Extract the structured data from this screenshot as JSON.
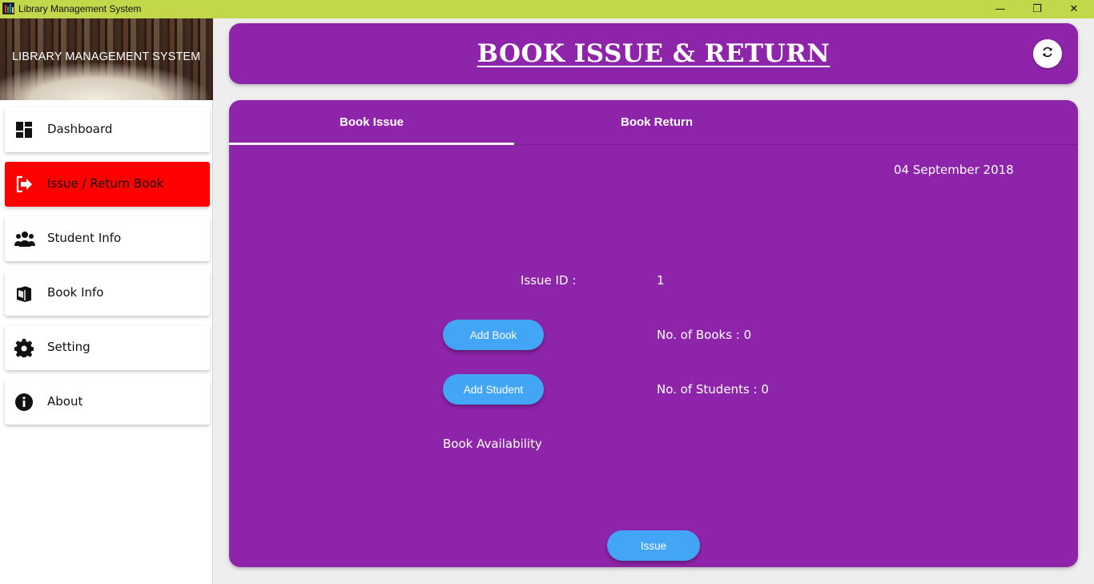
{
  "window": {
    "title": "Library Management System",
    "controls": {
      "minimize": "—",
      "maximize": "❐",
      "close": "✕"
    }
  },
  "sidebar": {
    "banner_title": "LIBRARY MANAGEMENT SYSTEM",
    "items": [
      {
        "label": "Dashboard",
        "icon": "dashboard-icon",
        "active": false
      },
      {
        "label": "Issue / Return Book",
        "icon": "exit-arrow-icon",
        "active": true
      },
      {
        "label": "Student Info",
        "icon": "users-icon",
        "active": false
      },
      {
        "label": "Book Info",
        "icon": "books-icon",
        "active": false
      },
      {
        "label": "Setting",
        "icon": "gear-icon",
        "active": false
      },
      {
        "label": "About",
        "icon": "info-icon",
        "active": false
      }
    ]
  },
  "header": {
    "title": "BOOK ISSUE & RETURN",
    "refresh_icon": "refresh-icon"
  },
  "tabs": [
    {
      "label": "Book Issue",
      "selected": true
    },
    {
      "label": "Book Return",
      "selected": false
    }
  ],
  "issue_form": {
    "date": "04 September 2018",
    "issue_id_label": "Issue ID :",
    "issue_id_value": "1",
    "add_book_label": "Add Book",
    "books_count_text": "No. of Books : 0",
    "add_student_label": "Add Student",
    "students_count_text": "No. of Students : 0",
    "availability_label": "Book Availability",
    "issue_button_label": "Issue"
  },
  "colors": {
    "titlebar": "#c2d84a",
    "primary": "#8e24aa",
    "active_nav": "#ff0000",
    "button": "#42a5f5"
  }
}
